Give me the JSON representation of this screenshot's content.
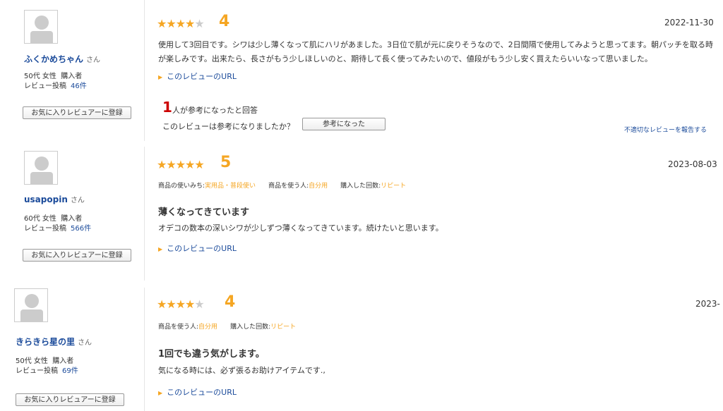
{
  "reviews": [
    {
      "user": "ふくかめちゃん",
      "honorific": "さん",
      "age_gender": "50代 女性",
      "buyer": "購入者",
      "posts_label": "レビュー投稿",
      "posts_count": "46件",
      "fav_button": "お気に入りレビュアーに登録",
      "rating": 4,
      "score": "4",
      "date": "2022-11-30",
      "text": "使用して3回目です。シワは少し薄くなって肌にハリがあました。3日位で肌が元に戻りそうなので、2日間隔で使用してみようと思ってます。朝パッチを取る時が楽しみです。出来たら、長さがもう少しほしいのと、期待して長く使ってみたいので、値段がもう少し安く買えたらいいなって思いました。",
      "url_label": "このレビューのURL",
      "helpful_count": "1",
      "helpful_text": "人が参考になったと回答",
      "question": "このレビューは参考になりましたか？",
      "helpful_button": "参考になった",
      "report": "不適切なレビューを報告する"
    },
    {
      "user": "usapopin",
      "honorific": "さん",
      "age_gender": "60代 女性",
      "buyer": "購入者",
      "posts_label": "レビュー投稿",
      "posts_count": "566件",
      "fav_button": "お気に入りレビュアーに登録",
      "rating": 5,
      "score": "5",
      "date": "2023-08-03",
      "tag1_label": "商品の使いみち:",
      "tag1_value": "実用品・普段使い",
      "tag2_label": "商品を使う人:",
      "tag2_value": "自分用",
      "tag3_label": "購入した回数:",
      "tag3_value": "リピート",
      "title": "薄くなってきています",
      "text": "オデコの数本の深いシワが少しずつ薄くなってきています。続けたいと思います。",
      "url_label": "このレビューのURL"
    },
    {
      "user": "きらきら星の里",
      "honorific": "さん",
      "age_gender": "50代 女性",
      "buyer": "購入者",
      "posts_label": "レビュー投稿",
      "posts_count": "69件",
      "fav_button": "お気に入りレビュアーに登録",
      "rating": 4,
      "score": "4",
      "date": "2023-",
      "tag1_label": "商品を使う人:",
      "tag1_value": "自分用",
      "tag2_label": "購入した回数:",
      "tag2_value": "リピート",
      "title": "1回でも違う気がします。",
      "text": "気になる時には、必ず張るお助けアイテムです.,",
      "url_label": "このレビューのURL"
    }
  ],
  "colors": {
    "star": "#f5a623",
    "link": "#1a4a9a",
    "helpful_num": "#cc0000"
  },
  "icons": {
    "star": "star-icon",
    "avatar": "default-avatar-icon",
    "triangle": "triangle-right-icon"
  }
}
